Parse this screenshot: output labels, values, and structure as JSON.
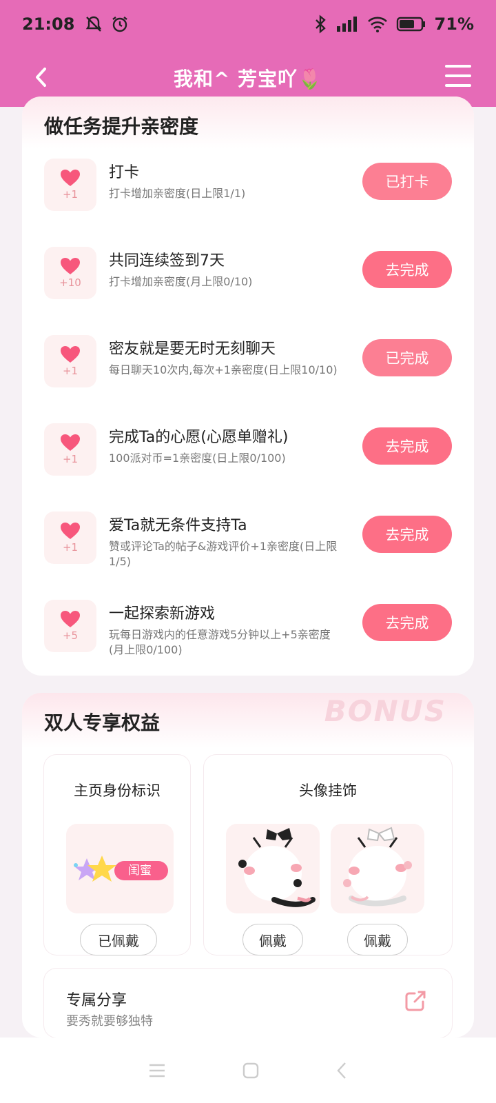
{
  "status_bar": {
    "time": "21:08",
    "battery": "71%",
    "battery_level": 0.71
  },
  "header": {
    "title": "我和^ 芳宝吖🌷"
  },
  "tasks_card": {
    "title": "做任务提升亲密度",
    "tasks": [
      {
        "points": "+1",
        "title": "打卡",
        "desc": "打卡增加亲密度(日上限1/1)",
        "button": "已打卡",
        "done": true
      },
      {
        "points": "+10",
        "title": "共同连续签到7天",
        "desc": "打卡增加亲密度(月上限0/10)",
        "button": "去完成",
        "done": false
      },
      {
        "points": "+1",
        "title": "密友就是要无时无刻聊天",
        "desc": "每日聊天10次内,每次+1亲密度(日上限10/10)",
        "button": "已完成",
        "done": true
      },
      {
        "points": "+1",
        "title": "完成Ta的心愿(心愿单赠礼)",
        "desc": "100派对币=1亲密度(日上限0/100)",
        "button": "去完成",
        "done": false
      },
      {
        "points": "+1",
        "title": "爱Ta就无条件支持Ta",
        "desc": "赞或评论Ta的帖子&游戏评价+1亲密度(日上限1/5)",
        "button": "去完成",
        "done": false
      },
      {
        "points": "+5",
        "title": "一起探索新游戏",
        "desc": "玩每日游戏内的任意游戏5分钟以上+5亲密度(月上限0/100)",
        "button": "去完成",
        "done": false
      }
    ]
  },
  "benefits_card": {
    "title": "双人专享权益",
    "watermark": "BONUS",
    "identity": {
      "title": "主页身份标识",
      "badge_text": "闺蜜",
      "button": "已佩戴"
    },
    "avatar_frame": {
      "title": "头像挂饰",
      "items": [
        {
          "icon": "black-bow-cat-frame-icon",
          "button": "佩戴"
        },
        {
          "icon": "white-bow-cat-frame-icon",
          "button": "佩戴"
        }
      ]
    },
    "share": {
      "title": "专属分享",
      "subtitle": "要秀就要够独特"
    }
  },
  "colors": {
    "header_bg": "#e66bb7",
    "button_pink": "#fd6f86",
    "heart": "#f7577c"
  }
}
